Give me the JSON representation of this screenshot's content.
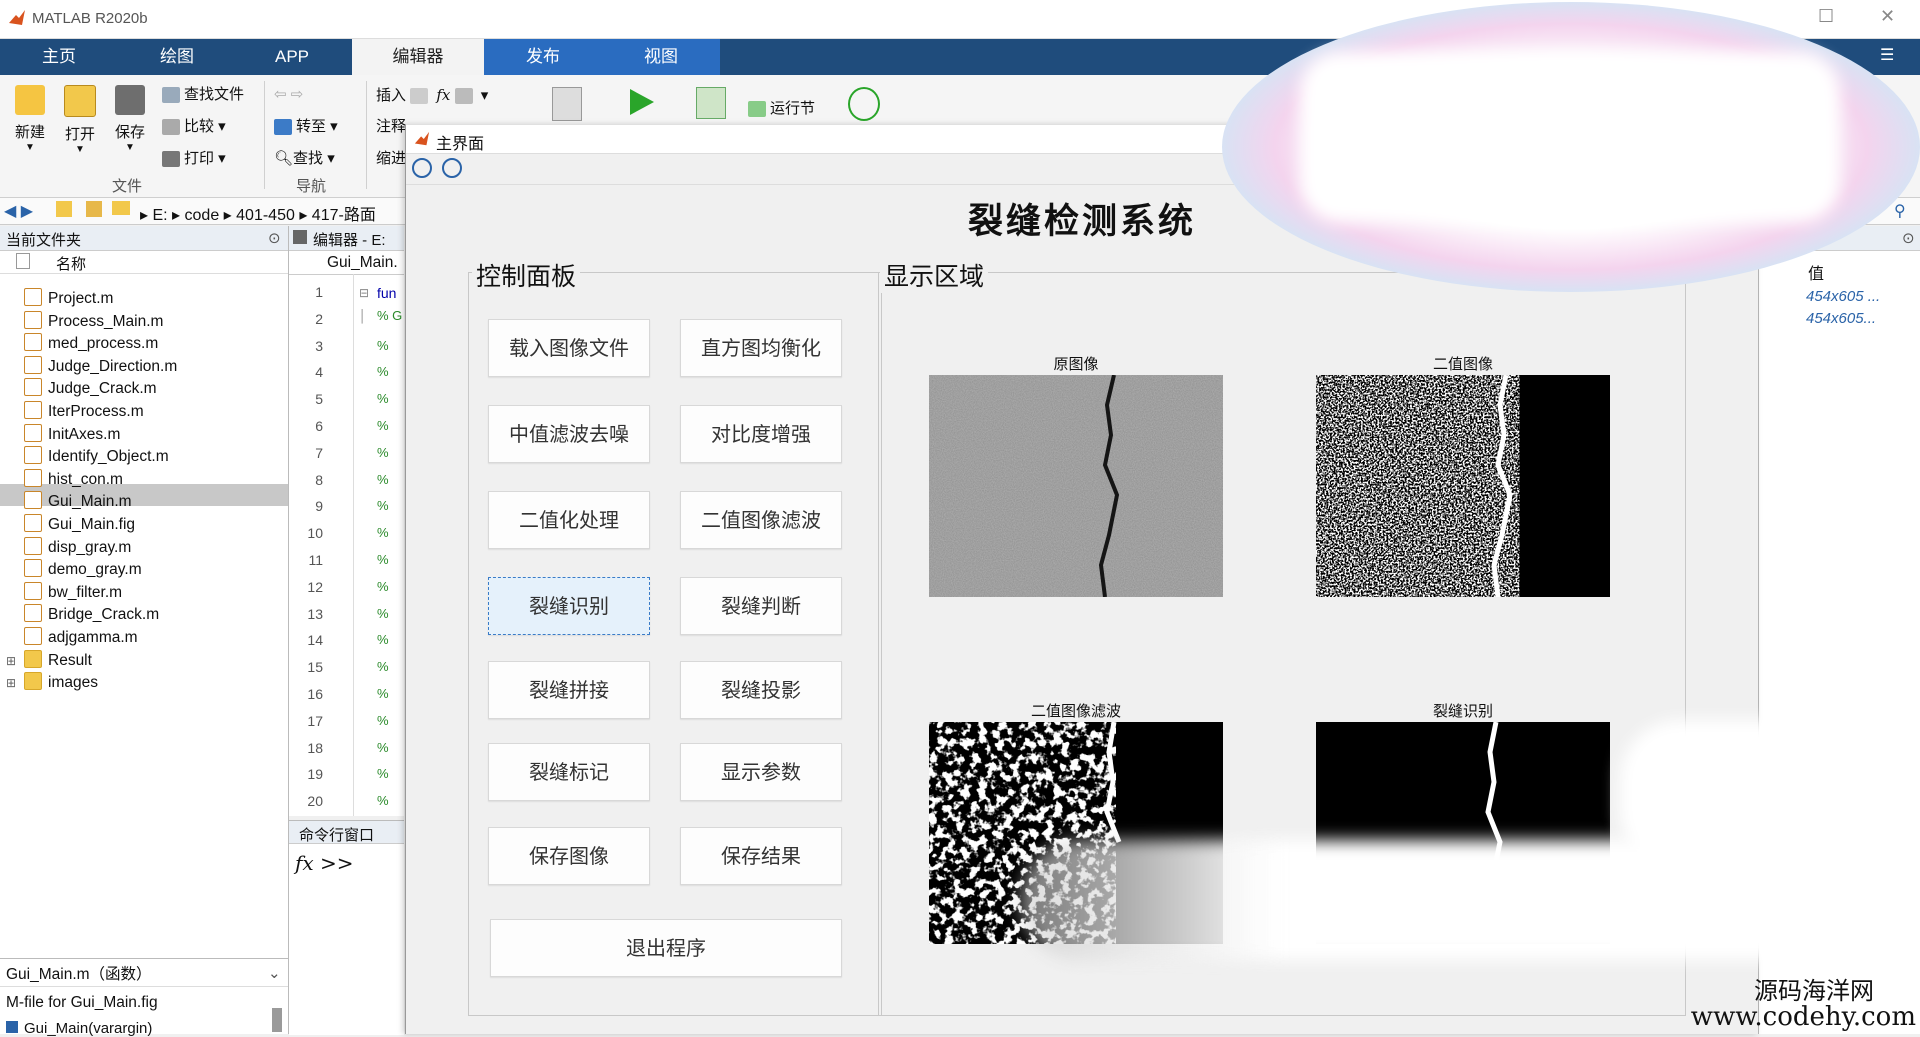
{
  "window": {
    "title": "MATLAB R2020b"
  },
  "tabs": [
    "主页",
    "绘图",
    "APP",
    "编辑器",
    "发布",
    "视图"
  ],
  "ribbon": {
    "new_label": "新建",
    "open_label": "打开",
    "save_label": "保存",
    "find_files": "查找文件",
    "compare": "比较",
    "print": "打印",
    "goto": "转至",
    "find": "查找",
    "insert": "插入",
    "comment": "注释",
    "indent": "缩进",
    "run_section": "运行节",
    "group_file": "文件",
    "group_nav": "导航"
  },
  "address": {
    "drive": "E:",
    "folder1": "code",
    "folder2": "401-450",
    "folder3": "417-路面"
  },
  "current_folder": {
    "title": "当前文件夹",
    "name_header": "名称",
    "files": [
      "Project.m",
      "Process_Main.m",
      "med_process.m",
      "Judge_Direction.m",
      "Judge_Crack.m",
      "IterProcess.m",
      "InitAxes.m",
      "Identify_Object.m",
      "hist_con.m",
      "Gui_Main.m",
      "Gui_Main.fig",
      "disp_gray.m",
      "demo_gray.m",
      "bw_filter.m",
      "Bridge_Crack.m",
      "adjgamma.m"
    ],
    "folders": [
      "Result",
      "images"
    ],
    "selected_file": "Gui_Main.m",
    "details_title": "Gui_Main.m（函数）",
    "details_line1": "M-file for Gui_Main.fig",
    "details_line2": "Gui_Main(varargin)"
  },
  "editor": {
    "title": "编辑器 - E:",
    "tab": "Gui_Main.",
    "line_numbers": [
      "1",
      "2",
      "3",
      "4",
      "5",
      "6",
      "7",
      "8",
      "9",
      "10",
      "11",
      "12",
      "13",
      "14",
      "15",
      "16",
      "17",
      "18",
      "19",
      "20"
    ],
    "first_line": "fun",
    "comment_mark": "%",
    "comment_g": "% G"
  },
  "command_window": {
    "title": "命令行窗口",
    "prompt": "fx >>"
  },
  "workspace": {
    "col_value": "值",
    "values": [
      "454x605 ...",
      "454x605..."
    ]
  },
  "figure": {
    "title": "主界面",
    "main_title": "裂缝检测系统",
    "control_panel_title": "控制面板",
    "display_panel_title": "显示区域",
    "buttons": [
      "载入图像文件",
      "直方图均衡化",
      "中值滤波去噪",
      "对比度增强",
      "二值化处理",
      "二值图像滤波",
      "裂缝识别",
      "裂缝判断",
      "裂缝拼接",
      "裂缝投影",
      "裂缝标记",
      "显示参数",
      "保存图像",
      "保存结果"
    ],
    "exit_button": "退出程序",
    "image_captions": [
      "原图像",
      "二值图像",
      "二值图像滤波",
      "裂缝识别"
    ]
  },
  "watermark": {
    "line1": "源码海洋网",
    "line2": "www.codehy.com"
  },
  "colors": {
    "tabstrip": "#1f4c7c",
    "active_tab": "#f3f3f3",
    "publish_tab": "#2a6cc0",
    "selected_file_bg": "#c8c8c8"
  }
}
